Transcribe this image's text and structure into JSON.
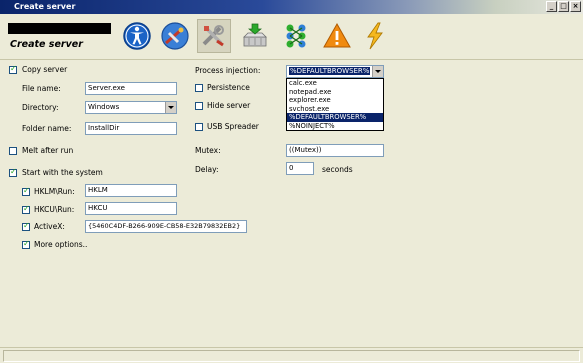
{
  "window": {
    "title": "Create server",
    "controls": [
      "_",
      "□",
      "×"
    ]
  },
  "header": {
    "app_title": "Create server",
    "toolbar": [
      {
        "icon": "accessibility-icon"
      },
      {
        "icon": "satellite-icon"
      },
      {
        "icon": "tools-icon"
      },
      {
        "icon": "download-icon"
      },
      {
        "icon": "puzzle-icon"
      },
      {
        "icon": "warning-icon"
      },
      {
        "icon": "lightning-icon"
      }
    ]
  },
  "form": {
    "copy_server": {
      "label": "Copy server",
      "checked": true
    },
    "file_name": {
      "label": "File name:",
      "value": "Server.exe"
    },
    "directory": {
      "label": "Directory:",
      "value": "Windows"
    },
    "folder_name": {
      "label": "Folder name:",
      "value": "InstallDir"
    },
    "melt": {
      "label": "Melt after run",
      "checked": false
    },
    "startup": {
      "label": "Start with the system",
      "checked": true
    },
    "hklm": {
      "label": "HKLM\\Run:",
      "value": "HKLM",
      "checked": true
    },
    "hkcu": {
      "label": "HKCU\\Run:",
      "value": "HKCU",
      "checked": true
    },
    "activex": {
      "label": "ActiveX:",
      "value": "{5460C4DF-B266-909E-CB58-E32B79832EB2}",
      "checked": true
    },
    "more_options": {
      "label": "More options..",
      "checked": true
    },
    "process_injection": {
      "label": "Process injection:",
      "value": "%DEFAULTBROWSER%",
      "options": [
        "calc.exe",
        "notepad.exe",
        "explorer.exe",
        "svchost.exe",
        "%DEFAULTBROWSER%",
        "%NOINJECT%"
      ],
      "selected_index": 4
    },
    "persistence": {
      "label": "Persistence",
      "checked": false
    },
    "hide_server": {
      "label": "Hide server",
      "checked": false
    },
    "usb_spreader": {
      "label": "USB Spreader",
      "checked": false
    },
    "mutex": {
      "label": "Mutex:",
      "value": "((Mutex))"
    },
    "delay": {
      "label": "Delay:",
      "value": "0",
      "unit": "seconds"
    }
  },
  "colors": {
    "background": "#ecebd8",
    "selection": "#0a246a",
    "checkmark": "#21a121",
    "input_border": "#7f9db9"
  }
}
